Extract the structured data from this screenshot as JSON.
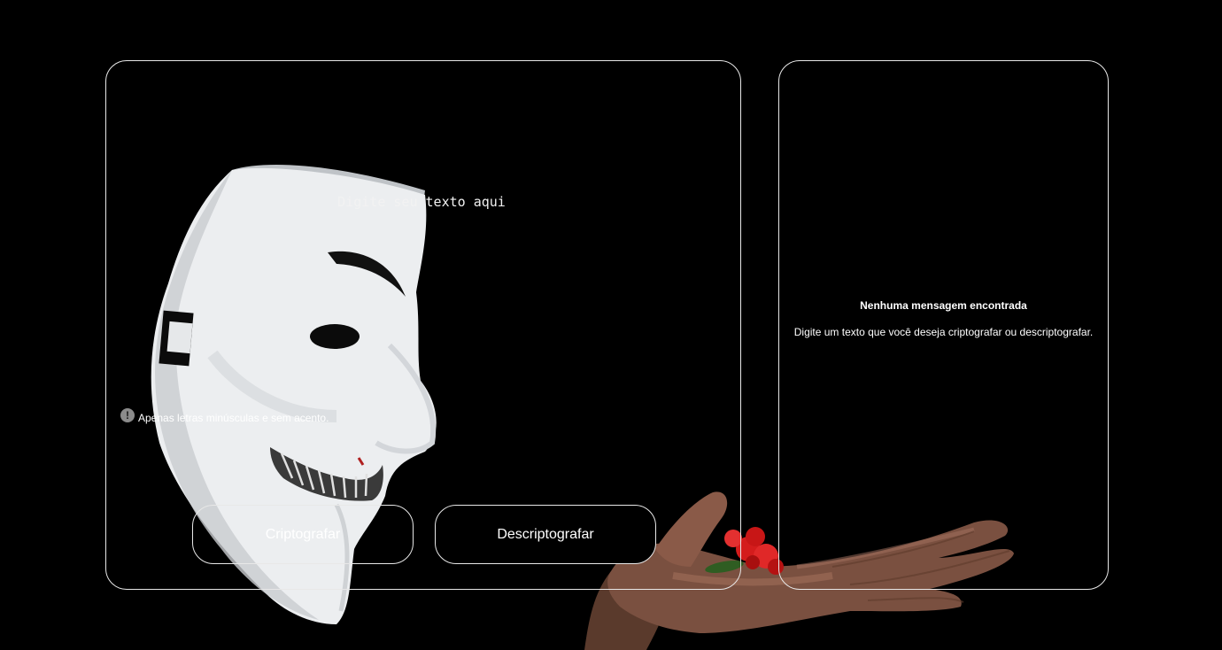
{
  "input": {
    "placeholder": "Digite seu texto aqui"
  },
  "hint": {
    "icon": "exclamation-circle-icon",
    "text": "Apenas letras minúsculas e sem acento."
  },
  "buttons": {
    "encrypt_label": "Criptografar",
    "decrypt_label": "Descriptografar"
  },
  "output": {
    "title": "Nenhuma mensagem encontrada",
    "description": "Digite um texto que você deseja criptografar ou descriptografar."
  },
  "colors": {
    "background": "#000000",
    "border": "#e8e8e8",
    "text": "#ffffff",
    "mask": "#e9ecef",
    "flower": "#d92020"
  }
}
